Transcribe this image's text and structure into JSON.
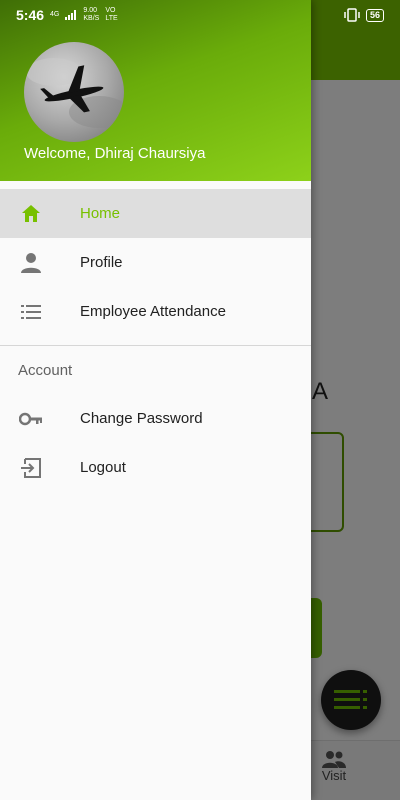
{
  "status_bar": {
    "time": "5:46",
    "signal_text_top": "4G",
    "speed_top": "9.00",
    "speed_bottom": "KB/S",
    "network_top": "VO",
    "network_bottom": "LTE",
    "battery": "56"
  },
  "drawer": {
    "welcome_text": "Welcome, Dhiraj Chaursiya",
    "menu_items": [
      {
        "label": "Home",
        "icon": "home-icon"
      },
      {
        "label": "Profile",
        "icon": "person-icon"
      },
      {
        "label": "Employee Attendance",
        "icon": "list-icon"
      }
    ],
    "account_section_label": "Account",
    "account_items": [
      {
        "label": "Change Password",
        "icon": "key-icon"
      },
      {
        "label": "Logout",
        "icon": "logout-icon"
      }
    ]
  },
  "background": {
    "title_fragment": "A",
    "bottom_nav_visit_label": "Visit"
  },
  "colors": {
    "accent": "#78c000",
    "header_dark": "#3f6e06",
    "header_light": "#8dd11a"
  }
}
